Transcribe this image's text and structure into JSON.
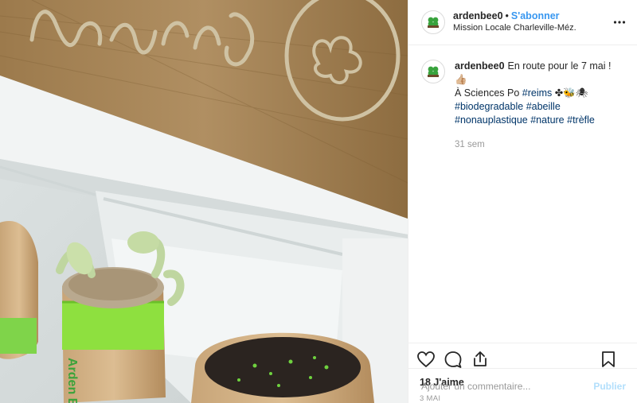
{
  "post": {
    "username": "ardenbee0",
    "follow_label": "S'abonner",
    "location": "Mission Locale Charleville-Méz.",
    "photo_sign_text": "Arden Bee",
    "caption_username": "ardenbee0",
    "caption_line1": "En route pour le 7 mai ! 👍🏼",
    "caption_line2": "À Sciences Po",
    "caption_emojis": "✤🐝🕷",
    "hashtags": [
      "#reims",
      "#biodegradable",
      "#abeille",
      "#nonauplastique",
      "#nature",
      "#trèfle"
    ],
    "age": "31 sem",
    "likes": "18 J'aime",
    "date": "3 MAI",
    "comment_placeholder": "Ajouter un commentaire...",
    "publish_label": "Publier"
  },
  "icons": {
    "avatar": "clover-logo-icon",
    "more": "more-options-icon",
    "like": "heart-icon",
    "comment": "comment-icon",
    "share": "share-icon",
    "save": "bookmark-icon"
  },
  "colors": {
    "accent": "#3897f0",
    "hashtag": "#003569",
    "muted": "#999999",
    "publish": "#b2dffc"
  }
}
